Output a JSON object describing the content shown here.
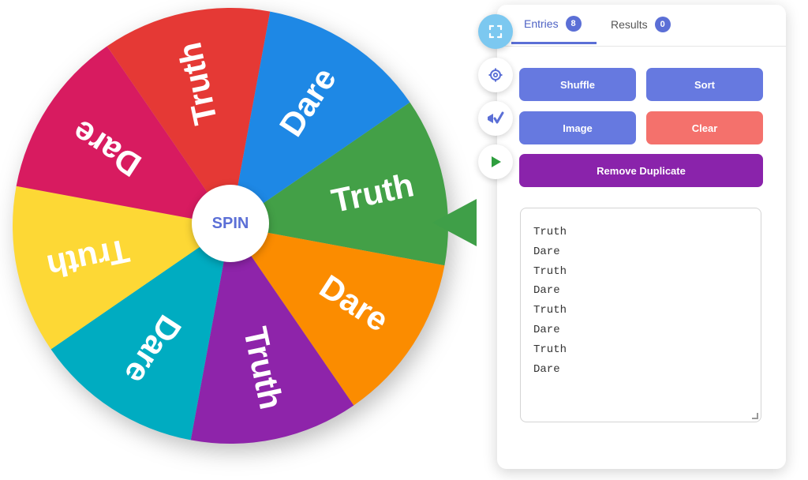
{
  "wheel": {
    "spin_label": "SPIN",
    "segments": [
      {
        "label": "Truth",
        "color": "#43a047"
      },
      {
        "label": "Dare",
        "color": "#fb8c00"
      },
      {
        "label": "Truth",
        "color": "#8e24aa"
      },
      {
        "label": "Dare",
        "color": "#00acc1"
      },
      {
        "label": "Truth",
        "color": "#fdd835"
      },
      {
        "label": "Dare",
        "color": "#d81b60"
      },
      {
        "label": "Truth",
        "color": "#e53935"
      },
      {
        "label": "Dare",
        "color": "#1e88e5"
      }
    ],
    "pointer_color": "#3f9f48"
  },
  "side_buttons": [
    {
      "icon": "fullscreen-icon"
    },
    {
      "icon": "settings-icon"
    },
    {
      "icon": "theme-icon"
    },
    {
      "icon": "play-icon"
    }
  ],
  "panel": {
    "tabs": [
      {
        "label": "Entries",
        "count": "8"
      },
      {
        "label": "Results",
        "count": "0"
      }
    ],
    "buttons": {
      "shuffle": "Shuffle",
      "sort": "Sort",
      "image": "Image",
      "clear": "Clear",
      "remove_duplicate": "Remove Duplicate"
    },
    "entries": [
      "Truth",
      "Dare",
      "Truth",
      "Dare",
      "Truth",
      "Dare",
      "Truth",
      "Dare"
    ]
  },
  "colors": {
    "accent": "#5b6fd6",
    "clear": "#f4716c",
    "remove_duplicate": "#8a23ab"
  }
}
